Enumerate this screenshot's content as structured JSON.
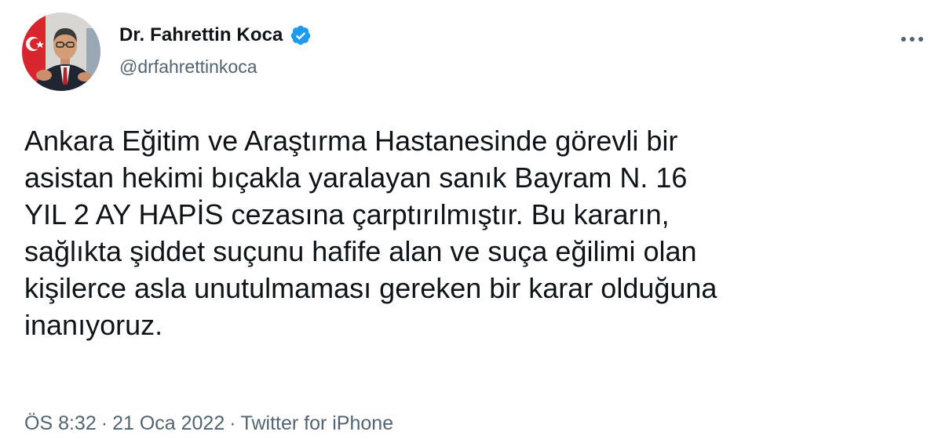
{
  "author": {
    "display_name": "Dr. Fahrettin Koca",
    "handle": "@drfahrettinkoca",
    "verified": true,
    "avatar_icon": "profile-photo"
  },
  "more_icon": "more-horizontal-icon",
  "tweet": {
    "text": "Ankara Eğitim ve Araştırma Hastanesinde görevli bir\nasistan hekimi bıçakla yaralayan sanık Bayram N. 16\nYIL 2 AY HAPİS cezasına çarptırılmıştır. Bu kararın,\nsağlıkta şiddet suçunu hafife alan ve suça eğilimi olan\nkişilerce asla unutulmaması gereken bir karar olduğuna\ninanıyoruz.",
    "time": "ÖS 8:32",
    "date": "21 Oca 2022",
    "separator": "·",
    "source": "Twitter for iPhone"
  },
  "colors": {
    "verified_badge": "#1d9bf0",
    "secondary_text": "#536471",
    "primary_text": "#0f1419"
  }
}
